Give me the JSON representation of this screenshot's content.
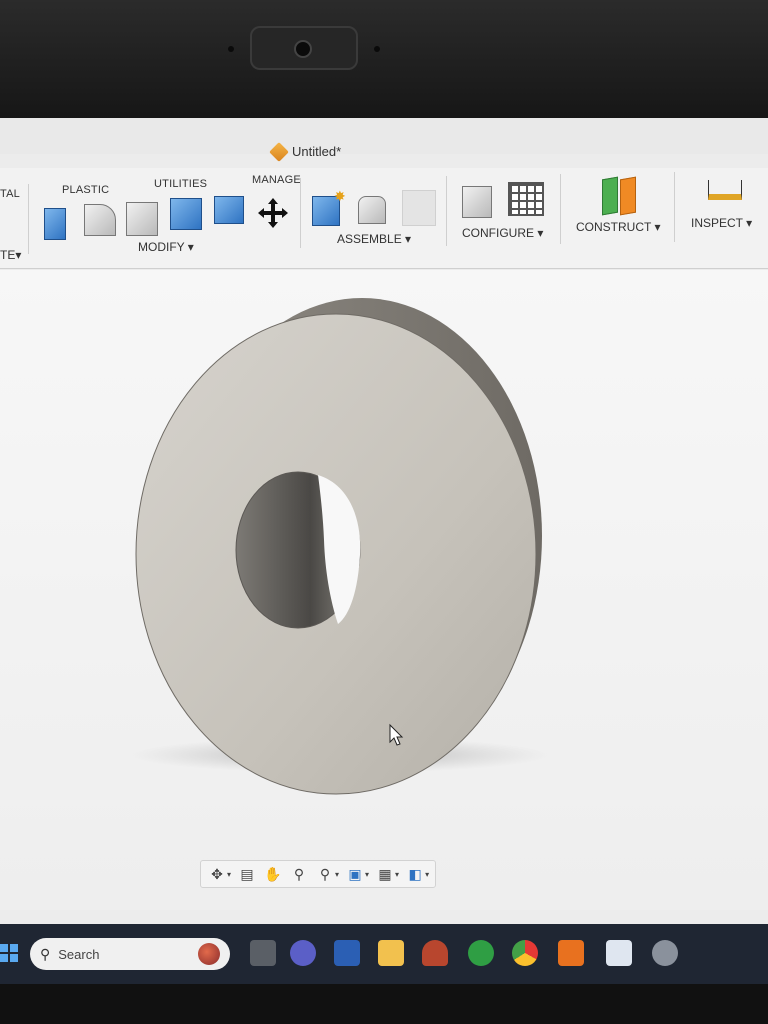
{
  "window": {
    "title": "Untitled*"
  },
  "toolbar": {
    "tabs": [
      "TAL",
      "PLASTIC",
      "UTILITIES",
      "MANAGE"
    ],
    "groups": {
      "modify": "MODIFY",
      "assemble": "ASSEMBLE",
      "configure": "CONFIGURE",
      "construct": "CONSTRUCT",
      "inspect": "INSPECT",
      "create_partial": "TE"
    },
    "caret": "▾"
  },
  "navigation_bar": {
    "icons": [
      "orbit-icon",
      "look-at-icon",
      "pan-icon",
      "zoom-icon",
      "zoom-window-icon",
      "display-settings-icon",
      "grid-icon",
      "viewports-icon"
    ]
  },
  "taskbar": {
    "search_placeholder": "Search",
    "icons": [
      "task-view-icon",
      "meet-icon",
      "word-icon",
      "file-explorer-icon",
      "app-icon",
      "xbox-icon",
      "chrome-icon",
      "fusion-icon",
      "app-icon-2",
      "settings-icon"
    ]
  },
  "colors": {
    "accent_blue": "#2f73c2",
    "model_face": "#c8c4bd",
    "taskbar_bg": "#1f2633"
  }
}
